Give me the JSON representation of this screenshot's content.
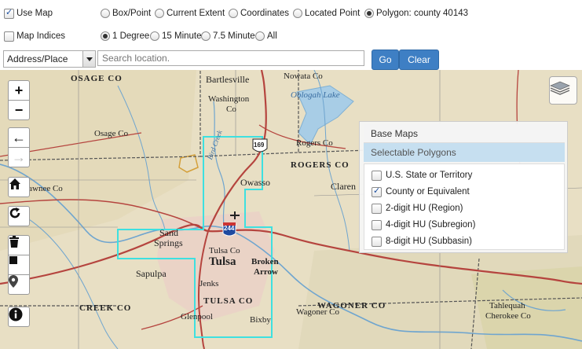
{
  "options_row1": {
    "use_map": {
      "label": "Use Map",
      "checked": true
    },
    "radios": [
      {
        "label": "Box/Point",
        "selected": false
      },
      {
        "label": "Current Extent",
        "selected": false
      },
      {
        "label": "Coordinates",
        "selected": false
      },
      {
        "label": "Located Point",
        "selected": false
      },
      {
        "label": "Polygon: county 40143",
        "selected": true
      }
    ]
  },
  "options_row2": {
    "map_indices": {
      "label": "Map Indices",
      "checked": false
    },
    "radios": [
      {
        "label": "1 Degree",
        "selected": true
      },
      {
        "label": "15 Minute",
        "selected": false
      },
      {
        "label": "7.5 Minute",
        "selected": false
      },
      {
        "label": "All",
        "selected": false
      }
    ]
  },
  "search": {
    "type_value": "Address/Place",
    "placeholder": "Search location.",
    "go_label": "Go",
    "clear_label": "Clear"
  },
  "map_controls": {
    "zoom_in": "+",
    "zoom_out": "−",
    "back": "←",
    "forward": "→"
  },
  "layer_panel": {
    "base_maps_label": "Base Maps",
    "selectable_label": "Selectable Polygons",
    "items": [
      {
        "label": "U.S. State or Territory",
        "checked": false
      },
      {
        "label": "County or Equivalent",
        "checked": true
      },
      {
        "label": "2-digit HU (Region)",
        "checked": false
      },
      {
        "label": "4-digit HU (Subregion)",
        "checked": false
      },
      {
        "label": "8-digit HU (Subbasin)",
        "checked": false
      }
    ]
  },
  "map_labels": {
    "osage_co": "OSAGE CO",
    "bartlesville": "Bartlesville",
    "washington_co": "Washington",
    "washington_co2": "Co",
    "nowata_co": "Nowata Co",
    "oologah_lake": "Oologah Lake",
    "pawnee_co": "Pawnee Co",
    "osage_co2": "Osage Co",
    "rogers_co": "Rogers Co",
    "rogers_co_caps": "ROGERS CO",
    "owasso": "Owasso",
    "claremore": "Claren",
    "sand_springs_1": "Sand",
    "sand_springs_2": "Springs",
    "tulsa_co": "Tulsa Co",
    "tulsa": "Tulsa",
    "broken_arrow_1": "Broken",
    "broken_arrow_2": "Arrow",
    "sapulpa": "Sapulpa",
    "jenks": "Jenks",
    "tulsa_co_caps": "TULSA CO",
    "creek_co": "CREEK CO",
    "glenpool": "Glenpool",
    "bixby": "Bixby",
    "wagoner_co_caps": "WAGONER CO",
    "wagoner_co": "Wagoner Co",
    "tahlequah": "Tahlequah",
    "cherokee_co": "Cherokee Co",
    "interstate": "244",
    "us_route": "169",
    "bird_creek": "Bird Creek"
  },
  "colors": {
    "accent": "#3e7fc4",
    "selection_outline": "#3ee0e0",
    "panel_highlight": "#c6dff0"
  }
}
